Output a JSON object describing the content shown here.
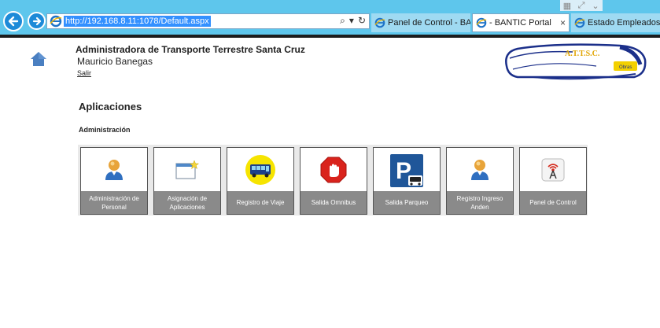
{
  "browser": {
    "url": "http://192.168.8.11:1078/Default.aspx",
    "tabs": [
      {
        "label": "Panel de Control - BA..."
      },
      {
        "label": "- BANTIC Portal",
        "close": "×"
      },
      {
        "label": "Estado Empleados"
      }
    ],
    "address_tools": {
      "search": "⌕",
      "dropdown": "▾",
      "refresh": "↻"
    }
  },
  "header": {
    "organization": "Administradora de Transporte Terrestre Santa Cruz",
    "user_name": "Mauricio Banegas",
    "logout_label": "Salir"
  },
  "logo": {
    "text": "A.T.T.S.C.",
    "badge": "Obras"
  },
  "main": {
    "section_title": "Aplicaciones",
    "group_title": "Administración",
    "tiles": [
      {
        "label": "Administración de Personal",
        "icon": "person-icon"
      },
      {
        "label": "Asignación de Aplicaciones",
        "icon": "window-star-icon"
      },
      {
        "label": "Registro de Viaje",
        "icon": "bus-icon"
      },
      {
        "label": "Salida Omnibus",
        "icon": "stop-hand-icon"
      },
      {
        "label": "Salida Parqueo",
        "icon": "parking-car-icon"
      },
      {
        "label": "Registro Ingreso Anden",
        "icon": "person-icon"
      },
      {
        "label": "Panel de Control",
        "icon": "antenna-icon"
      }
    ]
  },
  "colors": {
    "chrome": "#5ec6ec",
    "tile_label_bg": "#8a8a8a",
    "tiles_bg": "#e9e9e9"
  }
}
